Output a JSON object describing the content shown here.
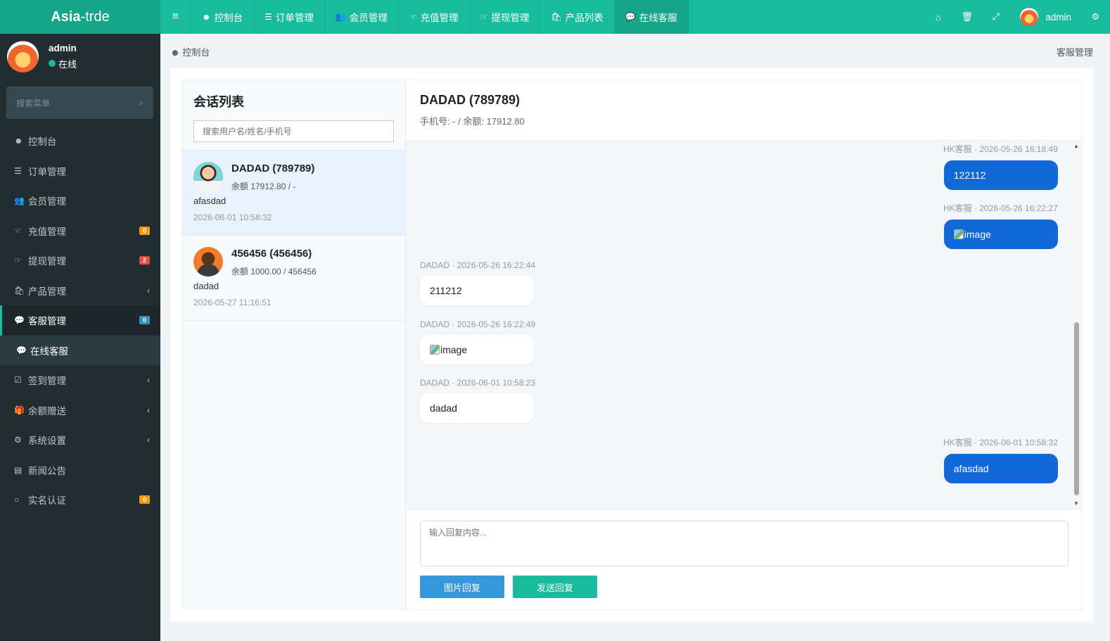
{
  "brand": {
    "bold": "Asia",
    "light": "-trde"
  },
  "topnav": [
    {
      "icon": "☻",
      "label": "控制台"
    },
    {
      "icon": "☰",
      "label": "订单管理"
    },
    {
      "icon": "👥",
      "label": "会员管理"
    },
    {
      "icon": "☜",
      "label": "充值管理"
    },
    {
      "icon": "☞",
      "label": "提现管理"
    },
    {
      "icon": "🛍",
      "label": "产品列表"
    },
    {
      "icon": "💬",
      "label": "在线客服"
    }
  ],
  "topright": {
    "user": "admin"
  },
  "user_panel": {
    "name": "admin",
    "status": "在线"
  },
  "sidebar_search": {
    "placeholder": "搜索菜单"
  },
  "menu": [
    {
      "icon": "☻",
      "label": "控制台",
      "badge": "",
      "arrow": ""
    },
    {
      "icon": "☰",
      "label": "订单管理",
      "badge": "",
      "arrow": ""
    },
    {
      "icon": "👥",
      "label": "会员管理",
      "badge": "",
      "arrow": ""
    },
    {
      "icon": "☜",
      "label": "充值管理",
      "badge": "0",
      "arrow": ""
    },
    {
      "icon": "☞",
      "label": "提现管理",
      "badge": "2",
      "arrow": ""
    },
    {
      "icon": "🛍",
      "label": "产品管理",
      "badge": "",
      "arrow": "‹"
    },
    {
      "icon": "💬",
      "label": "客服管理",
      "badge": "0",
      "arrow": ""
    },
    {
      "icon": "💬",
      "label": "在线客服",
      "badge": "",
      "arrow": ""
    },
    {
      "icon": "☑",
      "label": "签到管理",
      "badge": "",
      "arrow": "‹"
    },
    {
      "icon": "🎁",
      "label": "余额赠送",
      "badge": "",
      "arrow": "‹"
    },
    {
      "icon": "⚙",
      "label": "系统设置",
      "badge": "",
      "arrow": "‹"
    },
    {
      "icon": "▤",
      "label": "新闻公告",
      "badge": "",
      "arrow": ""
    },
    {
      "icon": "○",
      "label": "实名认证",
      "badge": "0",
      "arrow": ""
    }
  ],
  "breadcrumb": {
    "icon": "☻",
    "label": "控制台",
    "right": "客服管理"
  },
  "conversations": {
    "title": "会话列表",
    "search_placeholder": "搜索用户名/姓名/手机号",
    "items": [
      {
        "name": "DADAD (789789)",
        "sub": "余额 17912.80 / -",
        "last": "afasdad",
        "time": "2026-06-01 10:58:32"
      },
      {
        "name": "456456 (456456)",
        "sub": "余额 1000.00 / 456456",
        "last": "dadad",
        "time": "2026-05-27 11:16:51"
      }
    ]
  },
  "chat": {
    "title": "DADAD (789789)",
    "sub": "手机号: - / 余额: 17912.80",
    "messages": [
      {
        "meta": "HK客服 · 2026-05-26 16:18:49",
        "text": "122112"
      },
      {
        "meta": "HK客服 · 2026-05-26 16:22:27",
        "text": "image"
      },
      {
        "meta": "DADAD · 2026-05-26 16:22:44",
        "text": "211212"
      },
      {
        "meta": "DADAD · 2026-05-26 16:22:49",
        "text": "image"
      },
      {
        "meta": "DADAD · 2026-06-01 10:58:23",
        "text": "dadad"
      },
      {
        "meta": "HK客服 · 2026-06-01 10:58:32",
        "text": "afasdad"
      }
    ],
    "reply_placeholder": "输入回复内容...",
    "btn_image": "图片回复",
    "btn_send": "发送回复"
  }
}
